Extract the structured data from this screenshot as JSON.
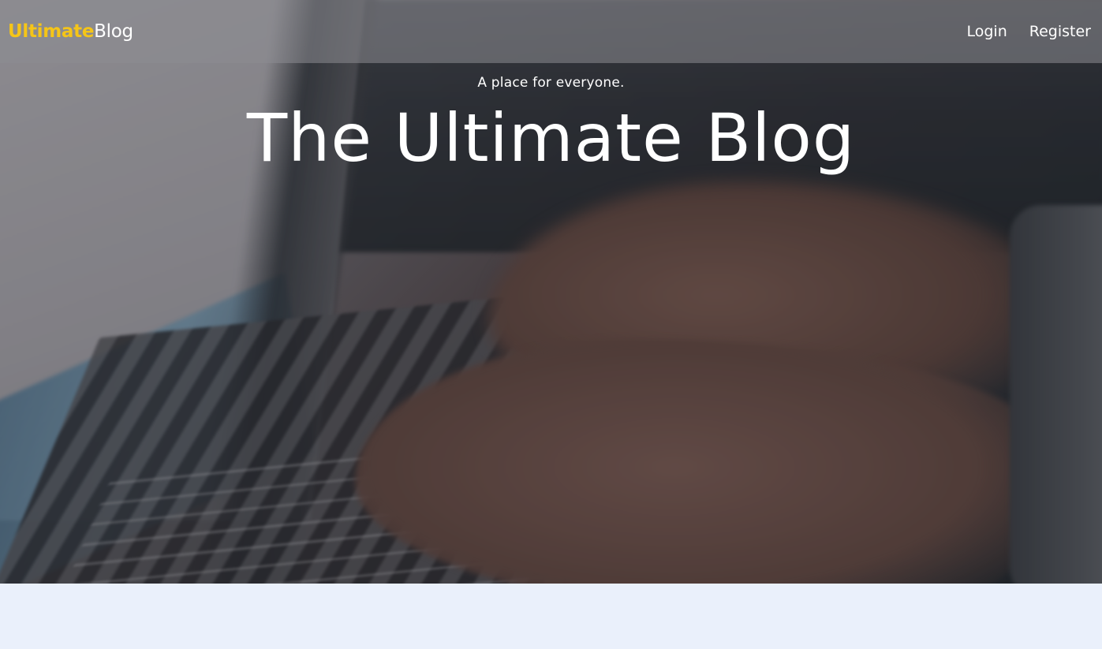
{
  "navbar": {
    "brand_part1": "Ultimate",
    "brand_part2": "Blog",
    "links": [
      {
        "label": "Login"
      },
      {
        "label": "Register"
      }
    ]
  },
  "hero": {
    "tagline": "A place for everyone.",
    "title": "The Ultimate Blog"
  },
  "colors": {
    "brand_accent": "#f5c518",
    "text_light": "#ffffff",
    "page_background": "#eaf0fb"
  }
}
